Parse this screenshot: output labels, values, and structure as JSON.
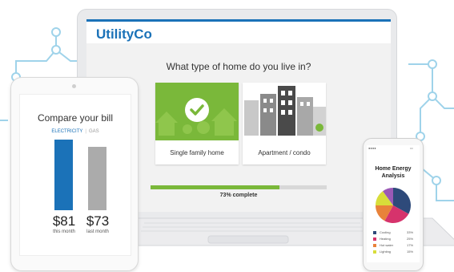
{
  "colors": {
    "brand": "#1b72b8",
    "accent_green": "#7ab83a",
    "bar_gray": "#ababab"
  },
  "laptop": {
    "brand": "UtilityCo",
    "question": "What type of home do you live in?",
    "options": [
      {
        "label": "Single family home",
        "selected": true,
        "icon": "check-icon"
      },
      {
        "label": "Apartment / condo",
        "selected": false
      }
    ],
    "progress": {
      "percent": 73,
      "label": "73% complete"
    }
  },
  "tablet": {
    "title": "Compare your bill",
    "tabs": {
      "active": "ELECTRICITY",
      "inactive": "GAS",
      "separator": "|"
    },
    "bars": [
      {
        "amount": "$81",
        "sublabel": "this month",
        "value": 81
      },
      {
        "amount": "$73",
        "sublabel": "last month",
        "value": 73
      }
    ]
  },
  "phone": {
    "title_line1": "Home Energy",
    "title_line2": "Analysis",
    "legend": [
      {
        "label": "Cooling",
        "percent": "33%",
        "color": "#2e4a7a"
      },
      {
        "label": "Heating",
        "percent": "25%",
        "color": "#d6336c"
      },
      {
        "label": "Hot water",
        "percent": "17%",
        "color": "#e8823a"
      },
      {
        "label": "Lighting",
        "percent": "15%",
        "color": "#d8dd3a"
      }
    ],
    "pie_slices": [
      {
        "value": 33,
        "color": "#2e4a7a"
      },
      {
        "value": 25,
        "color": "#d6336c"
      },
      {
        "value": 17,
        "color": "#e8823a"
      },
      {
        "value": 15,
        "color": "#d8dd3a"
      },
      {
        "value": 10,
        "color": "#9b59b6"
      }
    ]
  }
}
